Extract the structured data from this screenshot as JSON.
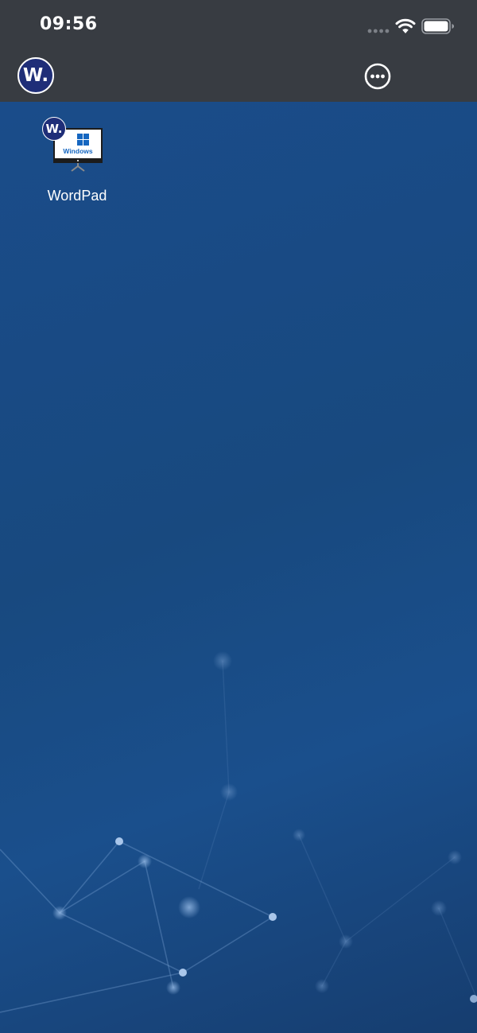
{
  "status_bar": {
    "time": "09:56"
  },
  "header": {
    "logo_text": "W.",
    "more_icon": "more-horizontal-circle-icon"
  },
  "desktop": {
    "apps": [
      {
        "label": "WordPad",
        "badge_text": "W.",
        "screen_text": "Windows",
        "icon": "windows-monitor-icon"
      }
    ]
  },
  "colors": {
    "topbar": "#383c42",
    "desktop_bg": "#1b4a82",
    "brand_navy": "#1f2e78",
    "windows_blue": "#1566c0"
  }
}
